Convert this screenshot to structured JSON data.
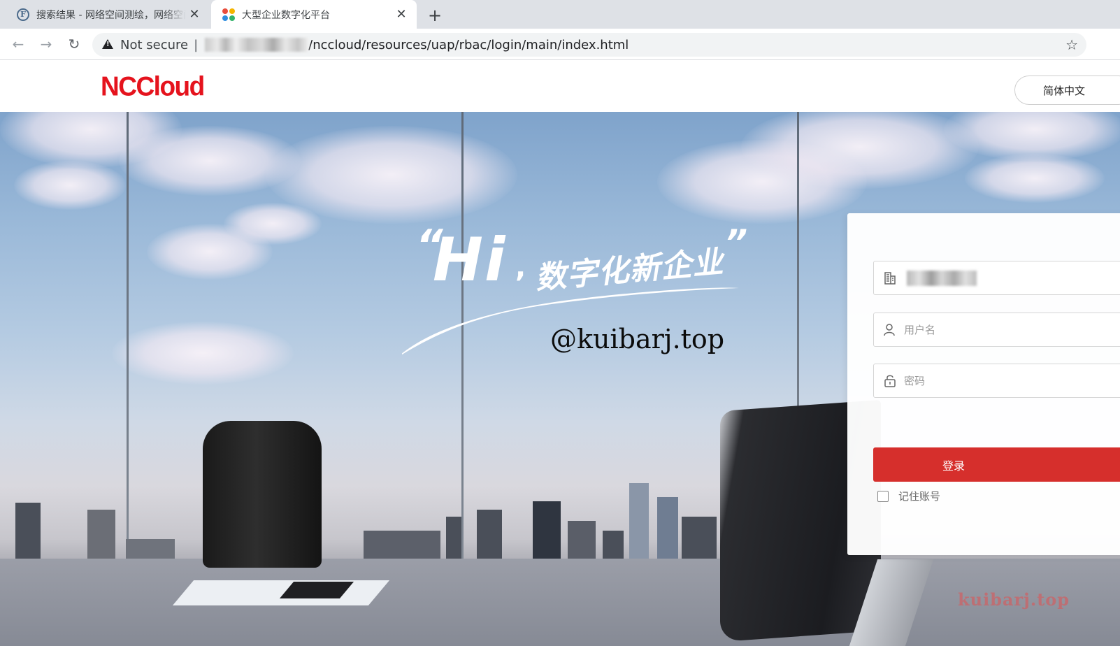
{
  "browser": {
    "tabs": [
      {
        "title": "搜索结果 - 网络空间测绘，网络空间安全搜索引擎",
        "icon": "fofa-icon",
        "active": false
      },
      {
        "title": "大型企业数字化平台",
        "icon": "yonyou-icon",
        "active": true
      }
    ],
    "close_glyph": "✕",
    "new_tab_glyph": "+",
    "nav": {
      "back": "←",
      "forward": "→",
      "reload": "↻"
    },
    "address": {
      "security_label": "Not secure",
      "separator": "|",
      "path": "/nccloud/resources/uap/rbac/login/main/index.html"
    },
    "star_glyph": "☆"
  },
  "header": {
    "logo_text": "NCCloud",
    "language": "简体中文"
  },
  "hero": {
    "quote_open": "“",
    "hi_text": "Hi",
    "comma": ",",
    "slogan": "数字化新企业",
    "quote_close": "”",
    "watermark": "@kuibarj.top"
  },
  "login": {
    "username_placeholder": "用户名",
    "password_placeholder": "密码",
    "submit_label": "登录",
    "remember_label": "记住账号"
  },
  "footer_watermark": "kuibarj.top",
  "colors": {
    "brand_red": "#e5131d",
    "login_button": "#d62f2c"
  }
}
